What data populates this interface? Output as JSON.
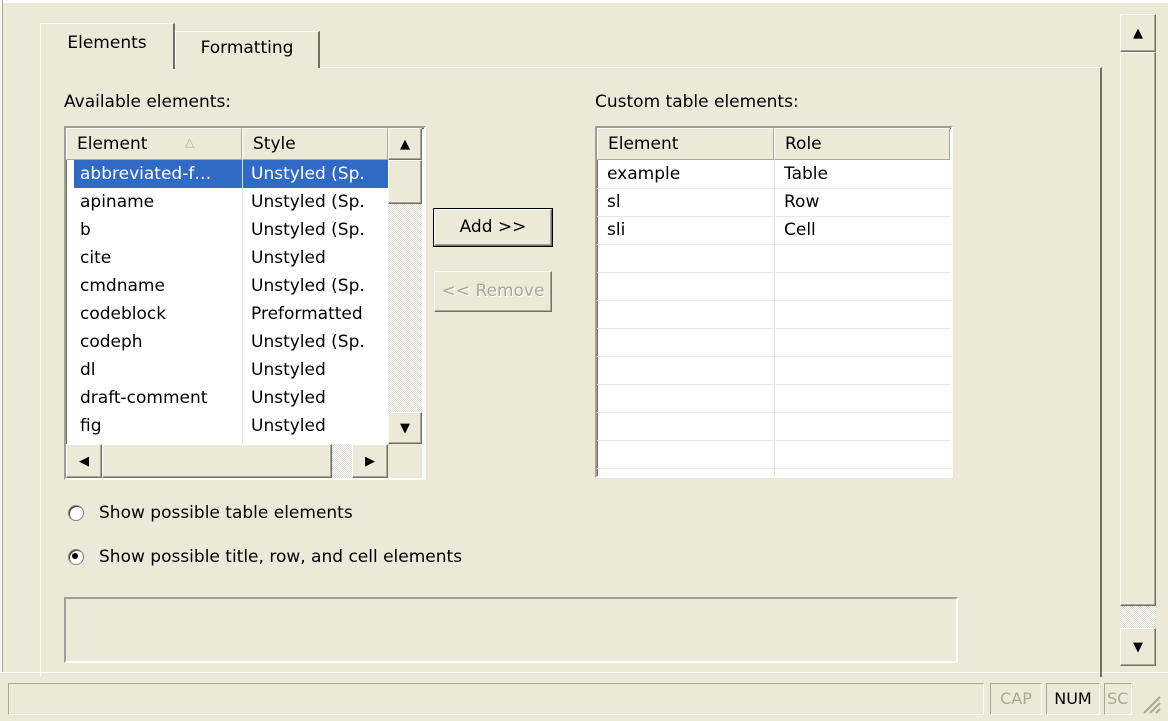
{
  "tabs": [
    {
      "label": "Elements",
      "active": true
    },
    {
      "label": "Formatting",
      "active": false
    }
  ],
  "available": {
    "label": "Available elements:",
    "columns": [
      "Element",
      "Style"
    ],
    "sort_icon": "sort-ascending-icon",
    "rows": [
      {
        "element": "abbreviated-f…",
        "style": "Unstyled (Sp.",
        "selected": true
      },
      {
        "element": "apiname",
        "style": "Unstyled (Sp."
      },
      {
        "element": "b",
        "style": "Unstyled (Sp."
      },
      {
        "element": "cite",
        "style": "Unstyled"
      },
      {
        "element": "cmdname",
        "style": "Unstyled (Sp."
      },
      {
        "element": "codeblock",
        "style": "Preformatted"
      },
      {
        "element": "codeph",
        "style": "Unstyled (Sp."
      },
      {
        "element": "dl",
        "style": "Unstyled"
      },
      {
        "element": "draft-comment",
        "style": "Unstyled"
      },
      {
        "element": "fig",
        "style": "Unstyled"
      }
    ]
  },
  "buttons": {
    "add": "Add >>",
    "remove": "<< Remove"
  },
  "custom": {
    "label": "Custom table elements:",
    "columns": [
      "Element",
      "Role"
    ],
    "rows": [
      {
        "element": "example",
        "role": "Table"
      },
      {
        "element": "sl",
        "role": "Row"
      },
      {
        "element": "sli",
        "role": "Cell"
      }
    ]
  },
  "radios": [
    {
      "label": "Show possible table elements",
      "checked": false
    },
    {
      "label": "Show possible title, row, and cell elements",
      "checked": true
    }
  ],
  "status_bar": {
    "indicators": [
      {
        "label": "CAP",
        "active": false
      },
      {
        "label": "NUM",
        "active": true
      },
      {
        "label": "SC",
        "active": false
      }
    ]
  },
  "colors": {
    "window_bg": "#ece9d8",
    "selection": "#316ac5"
  }
}
